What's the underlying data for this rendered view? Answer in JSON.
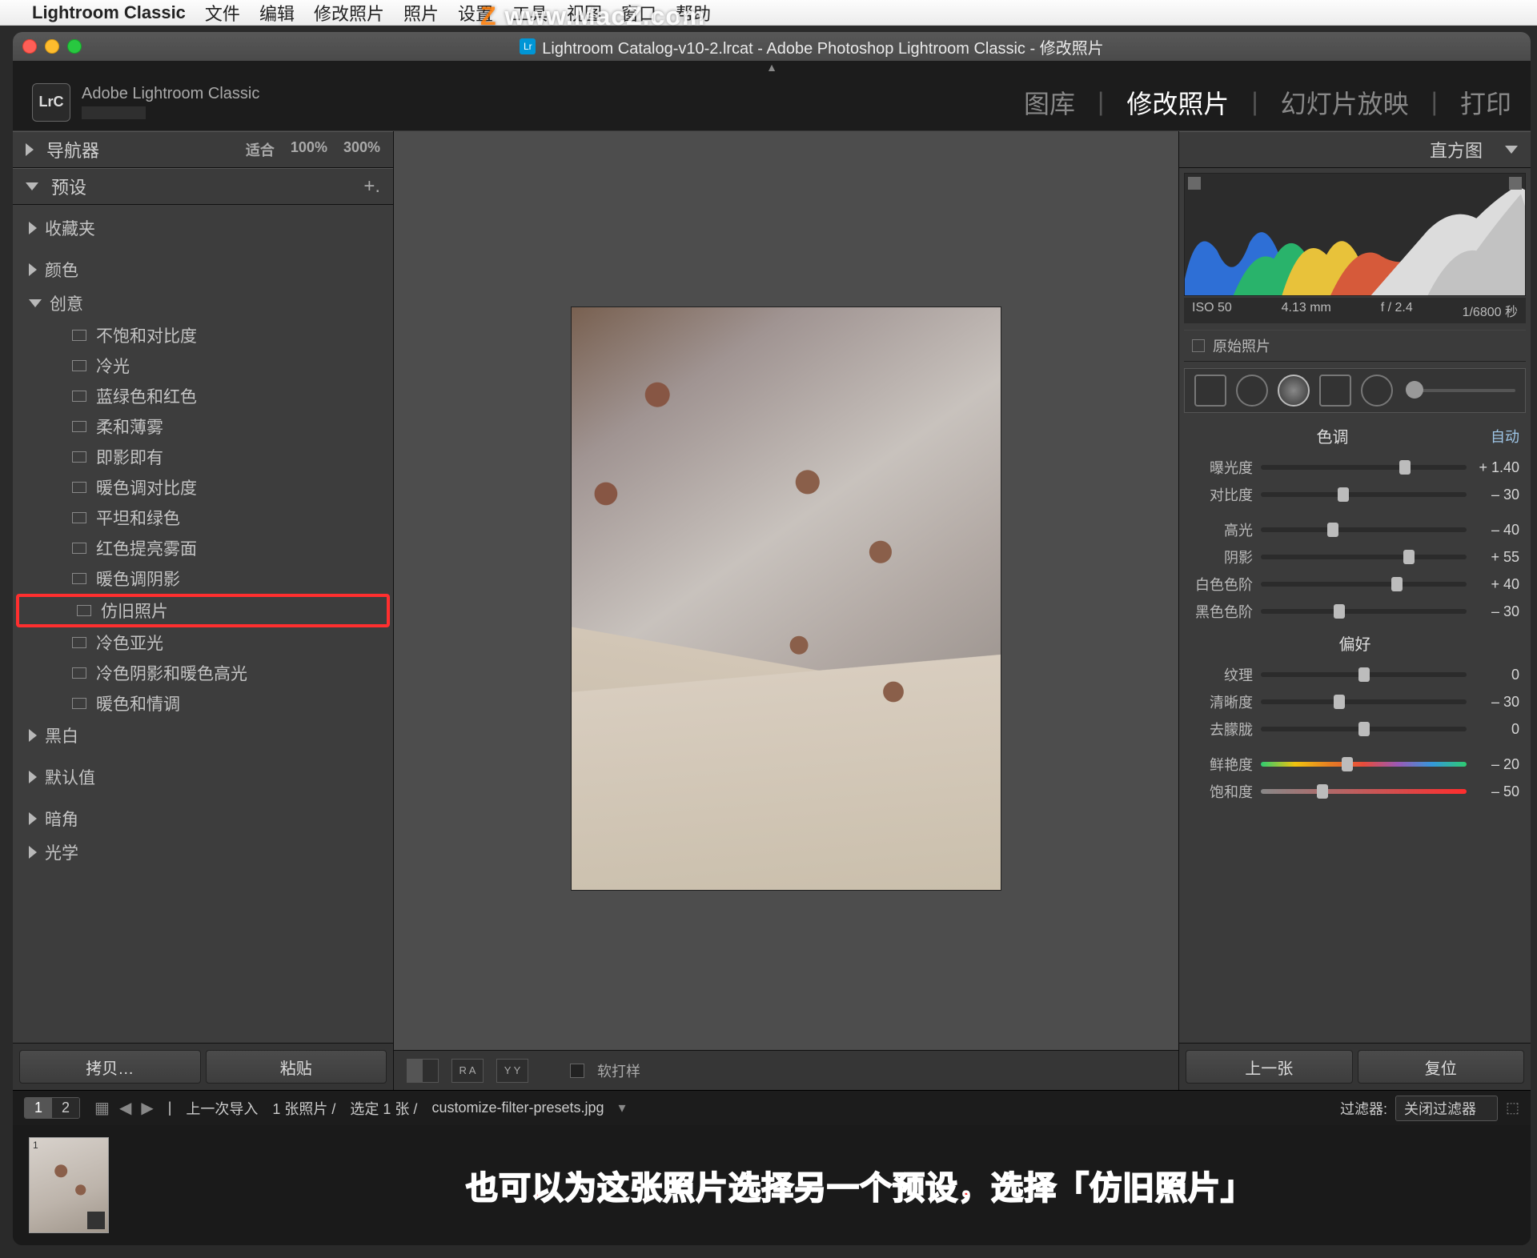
{
  "menubar": {
    "app": "Lightroom Classic",
    "items": [
      "文件",
      "编辑",
      "修改照片",
      "照片",
      "设置",
      "工具",
      "视图",
      "窗口",
      "帮助"
    ]
  },
  "watermark": "www.MacZ.com",
  "window": {
    "title": "Lightroom Catalog-v10-2.lrcat - Adobe Photoshop Lightroom Classic - 修改照片"
  },
  "brand": {
    "icon_text": "LrC",
    "name": "Adobe Lightroom Classic"
  },
  "modules": {
    "items": [
      "图库",
      "修改照片",
      "幻灯片放映",
      "打印"
    ],
    "active_index": 1
  },
  "left_panel": {
    "nav_title": "导航器",
    "zoom": [
      "适合",
      "100%",
      "300%"
    ],
    "presets_title": "预设",
    "groups": [
      {
        "label": "收藏夹",
        "expanded": false
      },
      {
        "label": "颜色",
        "expanded": false
      },
      {
        "label": "创意",
        "expanded": true,
        "items": [
          "不饱和对比度",
          "冷光",
          "蓝绿色和红色",
          "柔和薄雾",
          "即影即有",
          "暖色调对比度",
          "平坦和绿色",
          "红色提亮雾面",
          "暖色调阴影",
          "仿旧照片",
          "冷色亚光",
          "冷色阴影和暖色高光",
          "暖色和情调"
        ],
        "highlight_index": 9
      },
      {
        "label": "黑白",
        "expanded": false
      },
      {
        "label": "默认值",
        "expanded": false
      },
      {
        "label": "暗角",
        "expanded": false
      },
      {
        "label": "光学",
        "expanded": false
      }
    ],
    "copy_btn": "拷贝…",
    "paste_btn": "粘贴"
  },
  "center": {
    "softproof": "软打样"
  },
  "right_panel": {
    "hist_title": "直方图",
    "meta": {
      "iso": "ISO 50",
      "focal": "4.13 mm",
      "aperture": "f / 2.4",
      "shutter": "1/6800 秒"
    },
    "orig_label": "原始照片",
    "tone": {
      "title": "色调",
      "auto": "自动",
      "rows": [
        {
          "lbl": "曝光度",
          "val": "+ 1.40",
          "pos": 70
        },
        {
          "lbl": "对比度",
          "val": "– 30",
          "pos": 40
        }
      ]
    },
    "tone2": [
      {
        "lbl": "高光",
        "val": "– 40",
        "pos": 35
      },
      {
        "lbl": "阴影",
        "val": "+ 55",
        "pos": 72
      },
      {
        "lbl": "白色色阶",
        "val": "+ 40",
        "pos": 66
      },
      {
        "lbl": "黑色色阶",
        "val": "– 30",
        "pos": 38
      }
    ],
    "presence": {
      "title": "偏好",
      "rows": [
        {
          "lbl": "纹理",
          "val": "0",
          "pos": 50
        },
        {
          "lbl": "清晰度",
          "val": "– 30",
          "pos": 38
        },
        {
          "lbl": "去朦胧",
          "val": "0",
          "pos": 50
        }
      ]
    },
    "color": [
      {
        "lbl": "鲜艳度",
        "val": "– 20",
        "pos": 42,
        "cls": "color"
      },
      {
        "lbl": "饱和度",
        "val": "– 50",
        "pos": 30,
        "cls": "sat"
      }
    ],
    "prev_btn": "上一张",
    "reset_btn": "复位"
  },
  "statusbar": {
    "layouts": [
      "1",
      "2"
    ],
    "breadcrumb": "上一次导入",
    "count": "1 张照片 /",
    "selected": "选定 1 张 /",
    "filename": "customize-filter-presets.jpg",
    "filter_label": "过滤器:",
    "filter_value": "关闭过滤器"
  },
  "filmstrip": {
    "thumb_index": "1"
  },
  "annotation": "也可以为这张照片选择另一个预设，选择「仿旧照片」"
}
